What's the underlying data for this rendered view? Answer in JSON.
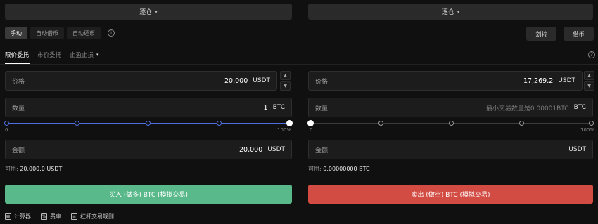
{
  "top_bar": {
    "left_margin_mode": "逐仓",
    "right_margin_mode": "逐仓"
  },
  "mode_tabs": [
    {
      "label": "手动",
      "active": true
    },
    {
      "label": "自动借币",
      "active": false
    },
    {
      "label": "自动还币",
      "active": false
    }
  ],
  "actions": {
    "transfer_label": "划转",
    "borrow_label": "借币"
  },
  "order_tabs": [
    {
      "label": "限价委托",
      "active": true
    },
    {
      "label": "市价委托",
      "active": false
    },
    {
      "label": "止盈止损",
      "active": false
    }
  ],
  "buy": {
    "price_label": "价格",
    "price_value": "20,000",
    "price_unit": "USDT",
    "amount_label": "数量",
    "amount_value": "1",
    "amount_unit": "BTC",
    "slider_min": "0",
    "slider_max": "100%",
    "slider_fraction": 1.0,
    "total_label": "金额",
    "total_value": "20,000",
    "total_unit": "USDT",
    "available_label": "可用:",
    "available_value": "20,000.0 USDT",
    "button_label": "买入 (做多) BTC (模拟交易)"
  },
  "sell": {
    "price_label": "价格",
    "price_value": "17,269.2",
    "price_unit": "USDT",
    "amount_label": "数量",
    "amount_placeholder": "最小交易数量是0.00001BTC",
    "amount_unit": "BTC",
    "slider_min": "0",
    "slider_max": "100%",
    "slider_fraction": 0.0,
    "total_label": "金额",
    "total_unit": "USDT",
    "available_label": "可用:",
    "available_value": "0.00000000 BTC",
    "button_label": "卖出 (做空) BTC (模拟交易)"
  },
  "footer": [
    {
      "icon": "calculator-icon",
      "label": "计算器"
    },
    {
      "icon": "rate-icon",
      "label": "费率"
    },
    {
      "icon": "rules-icon",
      "label": "杠杆交易规则"
    }
  ],
  "colors": {
    "buy": "#59b98b",
    "sell": "#d24c43",
    "slider_active": "#4f6fe0"
  }
}
